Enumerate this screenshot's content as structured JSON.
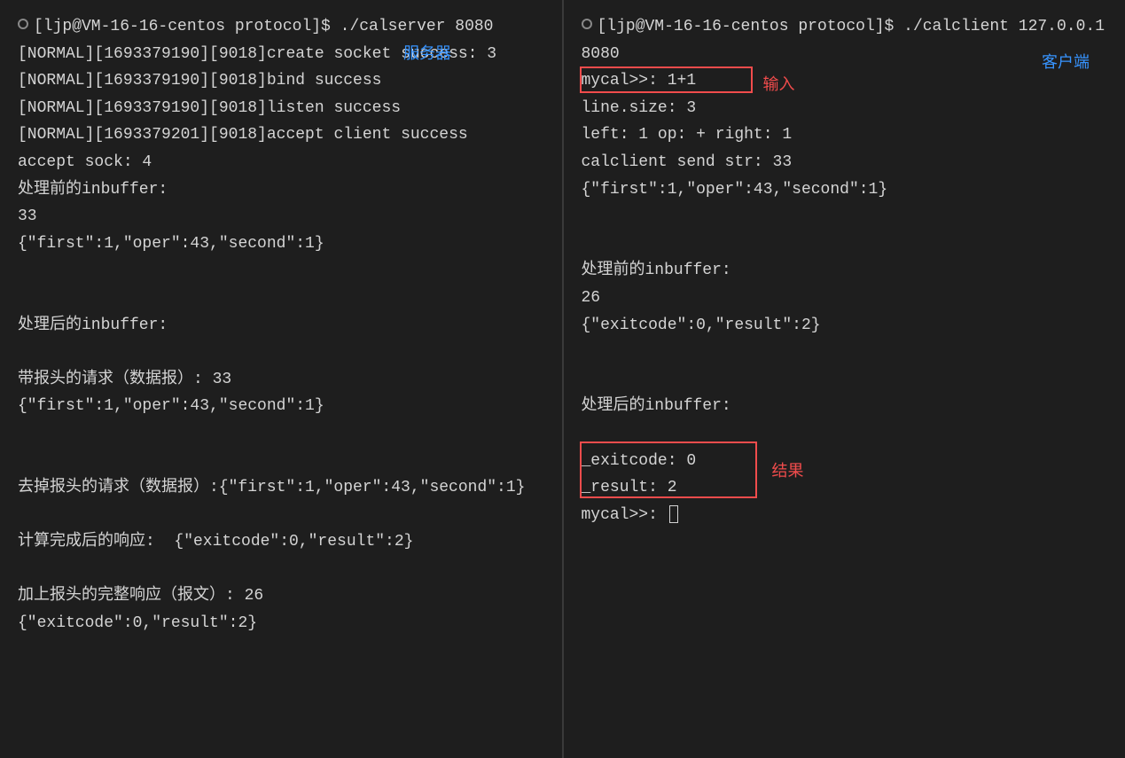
{
  "left": {
    "annotation_label": "服务器",
    "lines": [
      "[ljp@VM-16-16-centos protocol]$ ./calserver 8080",
      "[NORMAL][1693379190][9018]create socket success: 3",
      "[NORMAL][1693379190][9018]bind success",
      "[NORMAL][1693379190][9018]listen success",
      "[NORMAL][1693379201][9018]accept client success",
      "accept sock: 4",
      "处理前的inbuffer:",
      "33",
      "{\"first\":1,\"oper\":43,\"second\":1}",
      "",
      "",
      "处理后的inbuffer:",
      "",
      "带报头的请求（数据报）: 33",
      "{\"first\":1,\"oper\":43,\"second\":1}",
      "",
      "",
      "去掉报头的请求（数据报）:{\"first\":1,\"oper\":43,\"second\":1}",
      "",
      "计算完成后的响应:  {\"exitcode\":0,\"result\":2}",
      "",
      "加上报头的完整响应（报文）: 26",
      "{\"exitcode\":0,\"result\":2}"
    ]
  },
  "right": {
    "annotation_client": "客户端",
    "annotation_input": "输入",
    "annotation_result": "结果",
    "lines": [
      "[ljp@VM-16-16-centos protocol]$ ./calclient 127.0.0.1 8080",
      "mycal>>: 1+1",
      "line.size: 3",
      "left: 1 op: + right: 1",
      "calclient send str: 33",
      "{\"first\":1,\"oper\":43,\"second\":1}",
      "",
      "",
      "处理前的inbuffer:",
      "26",
      "{\"exitcode\":0,\"result\":2}",
      "",
      "",
      "处理后的inbuffer:",
      "",
      "_exitcode: 0",
      "_result: 2",
      "mycal>>: "
    ]
  }
}
